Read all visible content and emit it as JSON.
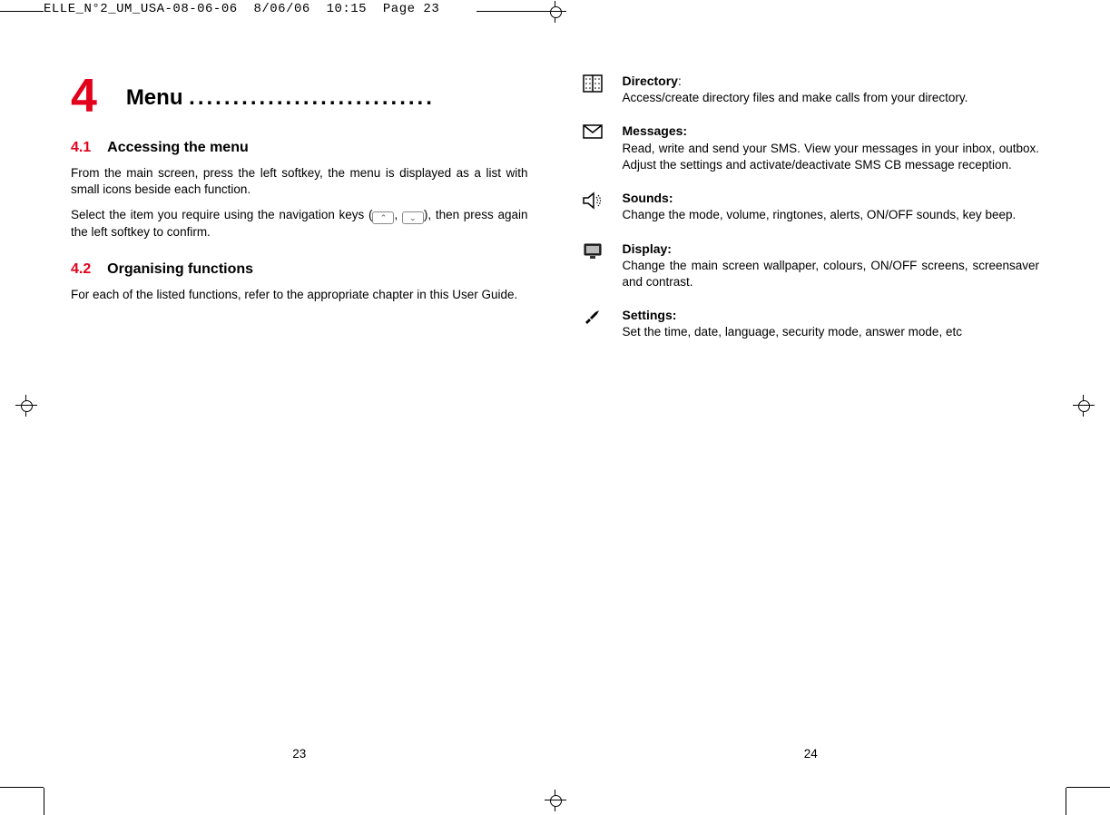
{
  "crop": {
    "filename": "ELLE_N°2_UM_USA-08-06-06",
    "date": "8/06/06",
    "time": "10:15",
    "pagetag": "Page 23"
  },
  "left": {
    "chapter_number": "4",
    "chapter_title": "Menu",
    "chapter_dots": "............................",
    "sections": [
      {
        "num": "4.1",
        "title": "Accessing the menu",
        "paras": [
          "From the main screen, press the left softkey, the menu is displayed as a list with small icons beside each function.",
          "Select the item you require using the navigation keys ( , ), then press again the left softkey to confirm."
        ],
        "navkey_para_prefix": "Select the item you require using the navigation keys (",
        "navkey_para_mid": ", ",
        "navkey_para_suffix": "), then press again the left softkey to confirm."
      },
      {
        "num": "4.2",
        "title": "Organising functions",
        "paras": [
          "For each of the listed functions, refer to the appropriate chapter in this User Guide."
        ]
      }
    ],
    "page_number": "23"
  },
  "right": {
    "features": [
      {
        "icon": "directory-icon",
        "title": "Directory",
        "sep": ":",
        "desc": "Access/create directory files and make calls from your directory."
      },
      {
        "icon": "messages-icon",
        "title": "Messages:",
        "sep": "",
        "desc": "Read, write and send your SMS. View your messages in your inbox, outbox. Adjust the settings and activate/deactivate SMS CB message reception."
      },
      {
        "icon": "sounds-icon",
        "title": "Sounds:",
        "sep": "",
        "desc": "Change the mode, volume, ringtones, alerts, ON/OFF sounds, key beep."
      },
      {
        "icon": "display-icon",
        "title": "Display:",
        "sep": "",
        "desc": "Change the main screen wallpaper, colours, ON/OFF screens, screensaver and contrast."
      },
      {
        "icon": "settings-icon",
        "title": "Settings:",
        "sep": "",
        "desc": "Set the time, date, language, security mode, answer mode, etc"
      }
    ],
    "page_number": "24"
  }
}
